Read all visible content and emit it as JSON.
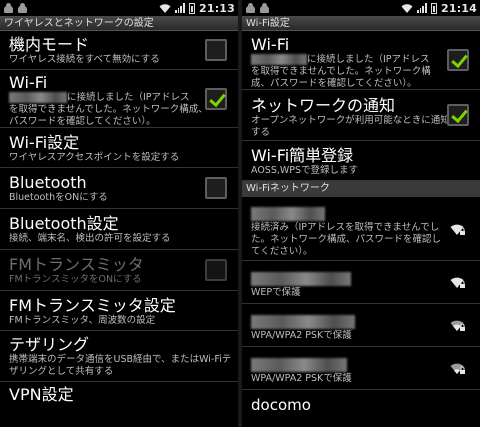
{
  "status_bar": {
    "left_time": "21:13",
    "right_time": "21:14"
  },
  "left_screen": {
    "title": "ワイヤレスとネットワークの設定",
    "items": [
      {
        "title": "機内モード",
        "subtitle": "ワイヤレス接続をすべて無効にする",
        "checkbox": "unchecked"
      },
      {
        "title": "Wi-Fi",
        "subtitle_line1": "に接続しました（IPアドレス",
        "subtitle_line2": "を取得できませんでした。ネットワーク構成、",
        "subtitle_line3": "パスワードを確認してください）。",
        "checkbox": "checked"
      },
      {
        "title": "Wi-Fi設定",
        "subtitle": "ワイヤレスアクセスポイントを設定する"
      },
      {
        "title": "Bluetooth",
        "subtitle": "BluetoothをONにする",
        "checkbox": "unchecked"
      },
      {
        "title": "Bluetooth設定",
        "subtitle": "接続、端末名、検出の許可を設定する"
      },
      {
        "title": "FMトランスミッタ",
        "subtitle": "FMトランスミッタをONにする",
        "checkbox": "disabled"
      },
      {
        "title": "FMトランスミッタ設定",
        "subtitle": "FMトランスミッタ、周波数の設定"
      },
      {
        "title": "テザリング",
        "subtitle_line1": "携帯端末のデータ通信をUSB経由で、またはWi-Fiテ",
        "subtitle_line2": "ザリングとして共有する"
      },
      {
        "title": "VPN設定"
      }
    ]
  },
  "right_screen": {
    "title": "Wi-Fi設定",
    "items": [
      {
        "title": "Wi-Fi",
        "subtitle_line1": "に接続しました（IPアドレス",
        "subtitle_line2": "を取得できませんでした。ネットワーク構",
        "subtitle_line3": "成、パスワードを確認してください）。",
        "checkbox": "checked"
      },
      {
        "title": "ネットワークの通知",
        "subtitle_line1": "オープンネットワークが利用可能なときに通知",
        "subtitle_line2": "する",
        "checkbox": "checked"
      },
      {
        "title": "Wi-Fi簡単登録",
        "subtitle": "AOSS,WPSで登録します"
      }
    ],
    "section_header": "Wi-Fiネットワーク",
    "networks": [
      {
        "status_line1": "接続済み（IPアドレスを取得できませんでし",
        "status_line2": "た。ネットワーク構成、パスワードを確認し",
        "status_line3": "てください）。",
        "icon": "wifi-locked-icon"
      },
      {
        "security": "WEPで保護",
        "icon": "wifi-locked-icon"
      },
      {
        "security": "WPA/WPA2 PSKで保護",
        "icon": "wifi-locked-icon"
      },
      {
        "security": "WPA/WPA2 PSKで保護",
        "icon": "wifi-locked-icon"
      },
      {
        "name": "docomo"
      }
    ]
  },
  "colors": {
    "check_green": "#7cd400",
    "titlebar": "#3a3a3a",
    "background": "#000000"
  }
}
